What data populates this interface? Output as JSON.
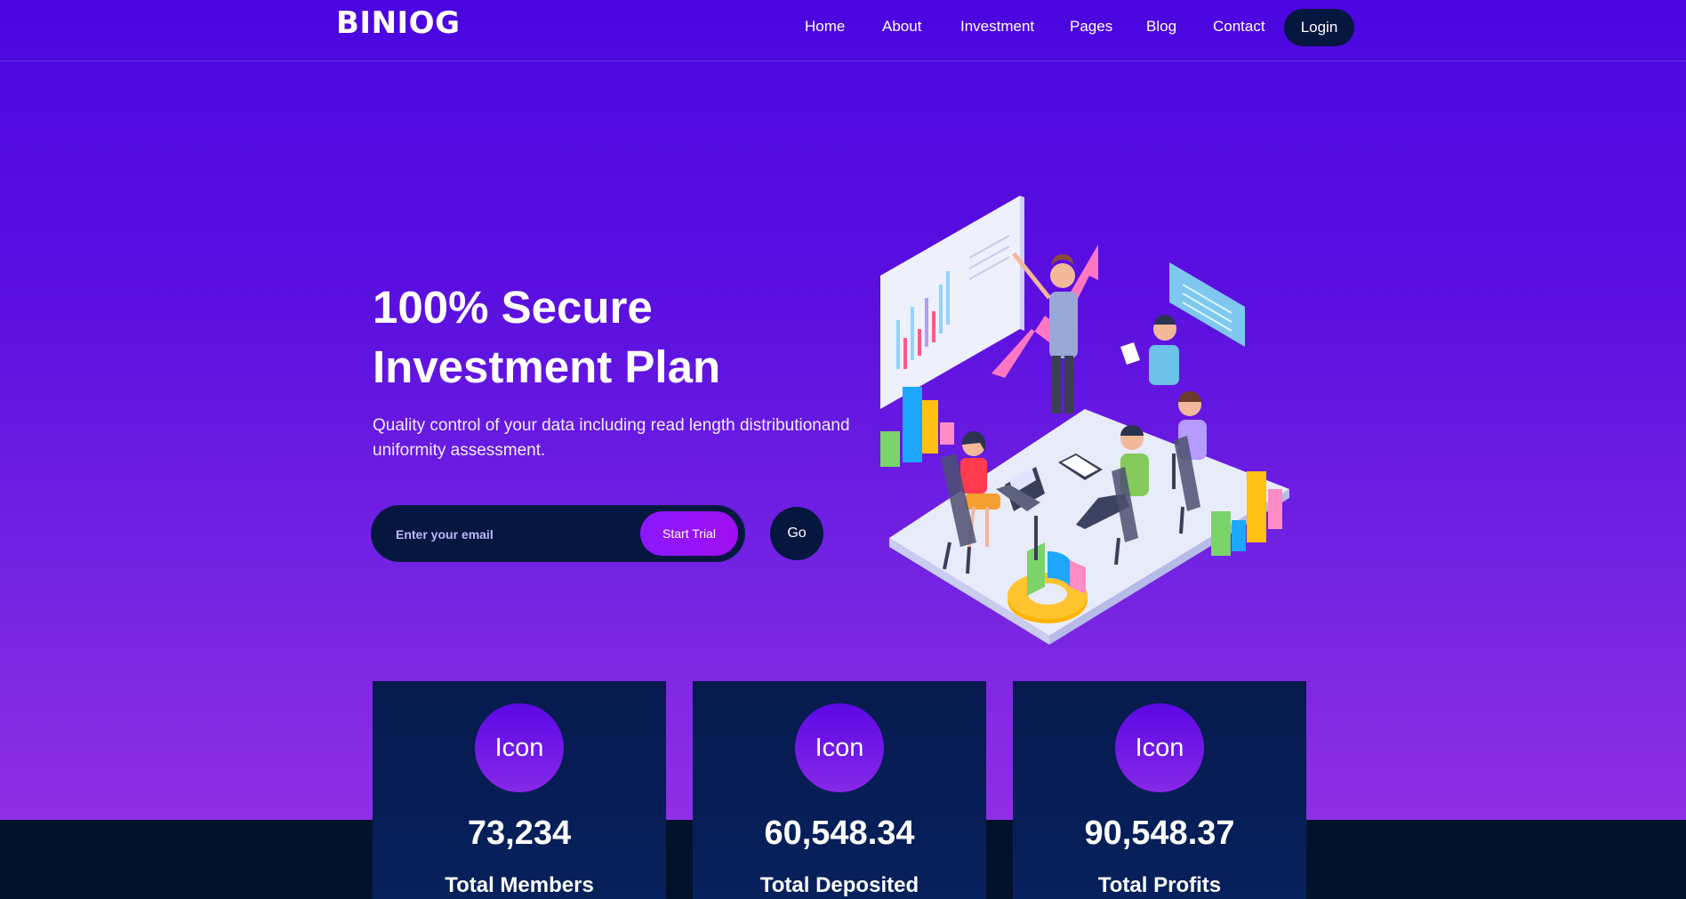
{
  "brand": {
    "logo": "BINIOG"
  },
  "nav": {
    "items": [
      {
        "label": "Home"
      },
      {
        "label": "About"
      },
      {
        "label": "Investment"
      },
      {
        "label": "Pages"
      },
      {
        "label": "Blog"
      },
      {
        "label": "Contact"
      }
    ],
    "login_label": "Login"
  },
  "hero": {
    "title_line1": "100% Secure",
    "title_line2": "Investment Plan",
    "subtitle_line1": "Quality control of your data including read length distributionand",
    "subtitle_line2": "uniformity assessment.",
    "email_placeholder": "Enter your email",
    "start_label": "Start Trial",
    "go_label": "Go"
  },
  "stats": [
    {
      "icon_text": "Icon",
      "value": "73,234",
      "label": "Total Members"
    },
    {
      "icon_text": "Icon",
      "value": "60,548.34",
      "label": "Total Deposited"
    },
    {
      "icon_text": "Icon",
      "value": "90,548.37",
      "label": "Total Profits"
    }
  ],
  "colors": {
    "hero_top": "#4b06e0",
    "hero_bottom": "#8f2fe3",
    "dark_navy": "#03122b",
    "card": "#061a4e",
    "accent_button": "#8a18ff"
  }
}
